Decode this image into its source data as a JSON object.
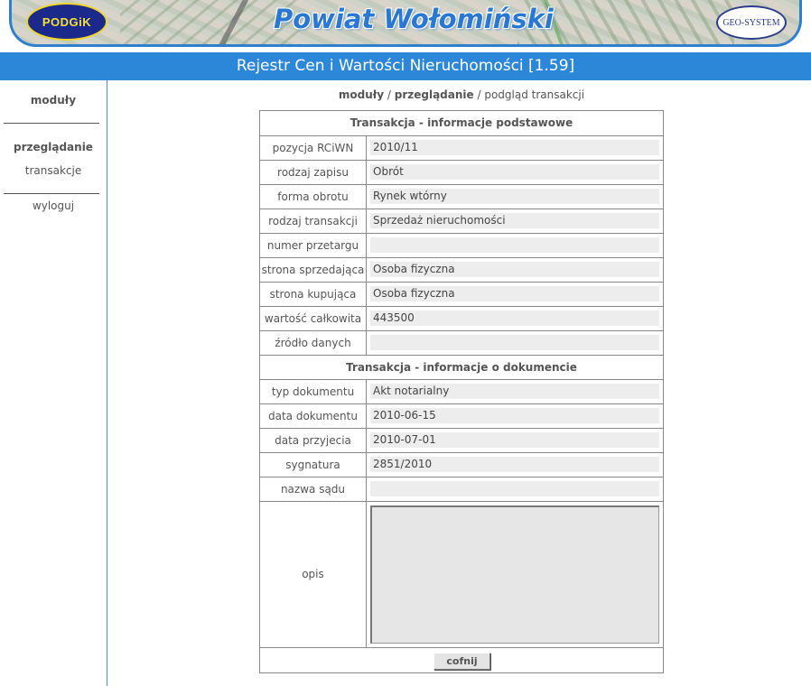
{
  "header": {
    "title": "Powiat Wołomiński",
    "logo_left_text": "PODGiK",
    "logo_right_text": "GEO-SYSTEM"
  },
  "app_title": "Rejestr Cen i Wartości Nieruchomości [1.59]",
  "sidebar": {
    "modules": "moduły",
    "browse_head": "przeglądanie",
    "transactions": "transakcje",
    "logout": "wyloguj"
  },
  "breadcrumb": {
    "part1": "moduły",
    "sep1": " / ",
    "part2": "przeglądanie",
    "sep2": " / ",
    "part3": "podgląd transakcji"
  },
  "form": {
    "section1": "Transakcja - informacje podstawowe",
    "section2": "Transakcja - informacje o dokumencie",
    "rows1": [
      {
        "label": "pozycja RCiWN",
        "value": "2010/11"
      },
      {
        "label": "rodzaj zapisu",
        "value": "Obrót"
      },
      {
        "label": "forma obrotu",
        "value": "Rynek wtórny"
      },
      {
        "label": "rodzaj transakcji",
        "value": "Sprzedaż nieruchomości"
      },
      {
        "label": "numer przetargu",
        "value": ""
      },
      {
        "label": "strona sprzedająca",
        "value": "Osoba fizyczna"
      },
      {
        "label": "strona kupująca",
        "value": "Osoba fizyczna"
      },
      {
        "label": "wartość całkowita",
        "value": "443500"
      },
      {
        "label": "źródło danych",
        "value": ""
      }
    ],
    "rows2": [
      {
        "label": "typ dokumentu",
        "value": "Akt notarialny"
      },
      {
        "label": "data dokumentu",
        "value": "2010-06-15"
      },
      {
        "label": "data przyjecia",
        "value": "2010-07-01"
      },
      {
        "label": "sygnatura",
        "value": "2851/2010"
      },
      {
        "label": "nazwa sądu",
        "value": ""
      }
    ],
    "description_label": "opis",
    "description_value": "",
    "back_button": "cofnij"
  }
}
